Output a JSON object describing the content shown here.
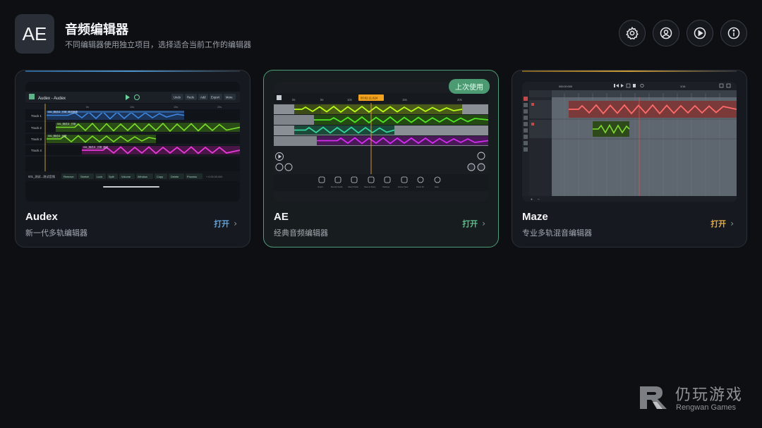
{
  "header": {
    "logo_text": "AE",
    "title": "音频编辑器",
    "subtitle": "不同编辑器使用独立项目，选择适合当前工作的编辑器"
  },
  "toolbar": {
    "icons": [
      "gear-icon",
      "account-icon",
      "play-circle-icon",
      "info-icon"
    ]
  },
  "cards": [
    {
      "name": "Audex",
      "desc": "新一代多轨编辑器",
      "open_label": "打开",
      "accent": "#4a90c8",
      "preview": {
        "title": "Audex - Audex",
        "buttons": [
          "Undo",
          "Redo",
          "Add",
          "Export",
          "More"
        ],
        "tracks": [
          "Track 1",
          "Track 2",
          "Track 3",
          "Track 4"
        ],
        "clip_labels": [
          "001_测试片_日常_测试音频",
          "001_测试片_日常",
          "001_测试片_日常",
          "001_测试片_日常_测试"
        ],
        "footer_label": "001_测试...测试音频",
        "tools": [
          "Remove",
          "Stretch",
          "Lock",
          "Split",
          "Volume",
          "Window",
          "Copy",
          "Delete",
          "Process"
        ],
        "time_readout": "+ 0:00:00.000",
        "ruler": [
          "5s",
          "10s",
          "15s",
          "20s"
        ]
      }
    },
    {
      "name": "AE",
      "desc": "经典音频编辑器",
      "open_label": "打开",
      "accent": "#4f9c78",
      "badge": "上次使用",
      "preview": {
        "ruler": [
          "0s",
          "5s",
          "10s",
          "15s",
          "20s"
        ],
        "playhead_time": "00:02:11.624",
        "tools": [
          "Import",
          "Record Audio",
          "Clear Picker",
          "Save & Done",
          "Settings",
          "Home View",
          "Zoom Fit",
          "Help"
        ]
      }
    },
    {
      "name": "Maze",
      "desc": "专业多轨混音编辑器",
      "open_label": "打开",
      "accent": "#c99a36",
      "preview": {
        "time_readout": "000:00:000",
        "meter": "1/16"
      }
    }
  ],
  "watermark": {
    "cn": "仍玩游戏",
    "en": "Rengwan Games"
  },
  "colors": {
    "audex_open": "#5da2e0",
    "ae_open": "#56c08a",
    "maze_open": "#e7a93c"
  }
}
